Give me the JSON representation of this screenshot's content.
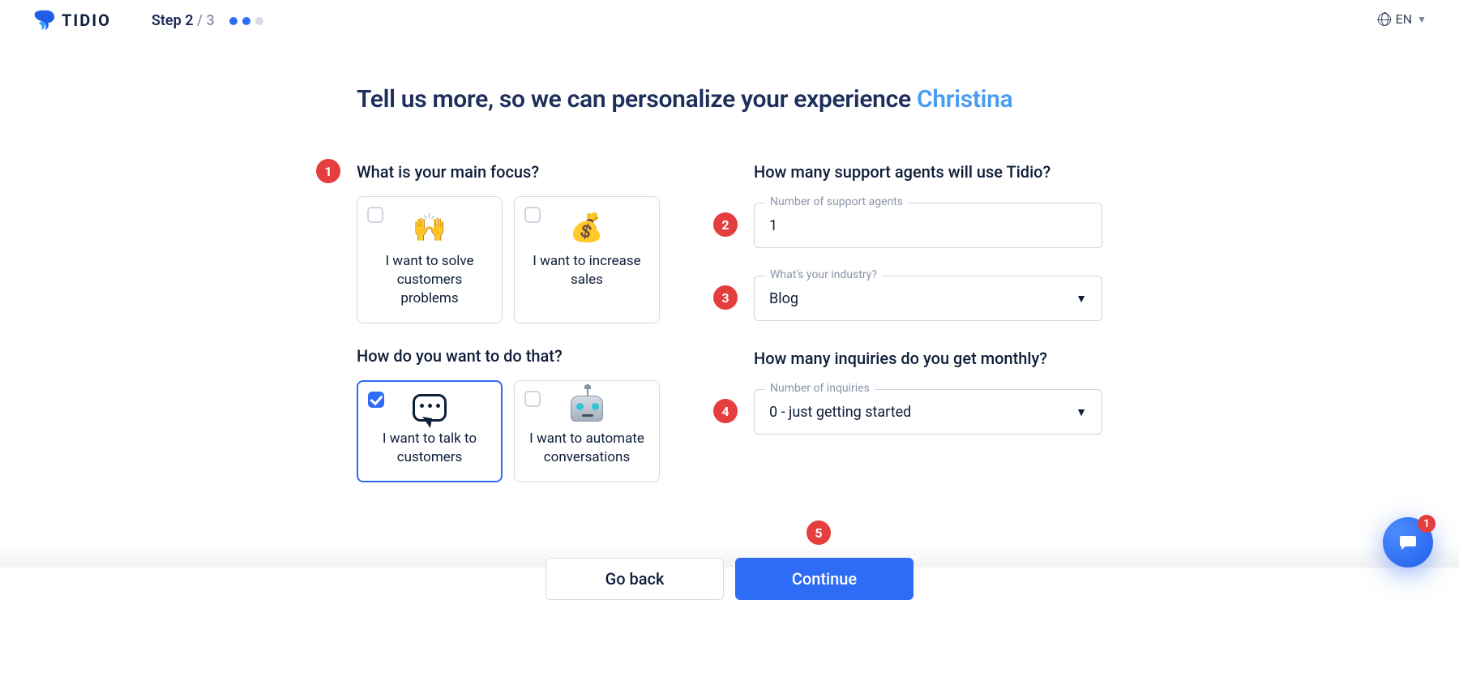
{
  "header": {
    "brand": "TIDIO",
    "step_prefix": "Step",
    "step_current": "2",
    "step_total": "/ 3",
    "lang": "EN"
  },
  "title": {
    "lead": "Tell us more, so we can personalize your experience ",
    "name": "Christina"
  },
  "left": {
    "q1": "What is your main focus?",
    "cards1": [
      {
        "label": "I want to solve customers problems",
        "emoji": "🙌"
      },
      {
        "label": "I want to increase sales",
        "emoji": "💰"
      }
    ],
    "q2": "How do you want to do that?",
    "cards2": [
      {
        "label": "I want to talk to customers",
        "selected": true
      },
      {
        "label": "I want to automate conversations",
        "selected": false
      }
    ]
  },
  "right": {
    "q_agents": "How many support agents will use Tidio?",
    "agents_label": "Number of support agents",
    "agents_value": "1",
    "industry_label": "What's your industry?",
    "industry_value": "Blog",
    "q_inquiries": "How many inquiries do you get monthly?",
    "inquiries_label": "Number of inquiries",
    "inquiries_value": "0 - just getting started"
  },
  "footer": {
    "back": "Go back",
    "continue": "Continue"
  },
  "markers": {
    "m1": "1",
    "m2": "2",
    "m3": "3",
    "m4": "4",
    "m5": "5"
  },
  "chat": {
    "badge": "1"
  }
}
